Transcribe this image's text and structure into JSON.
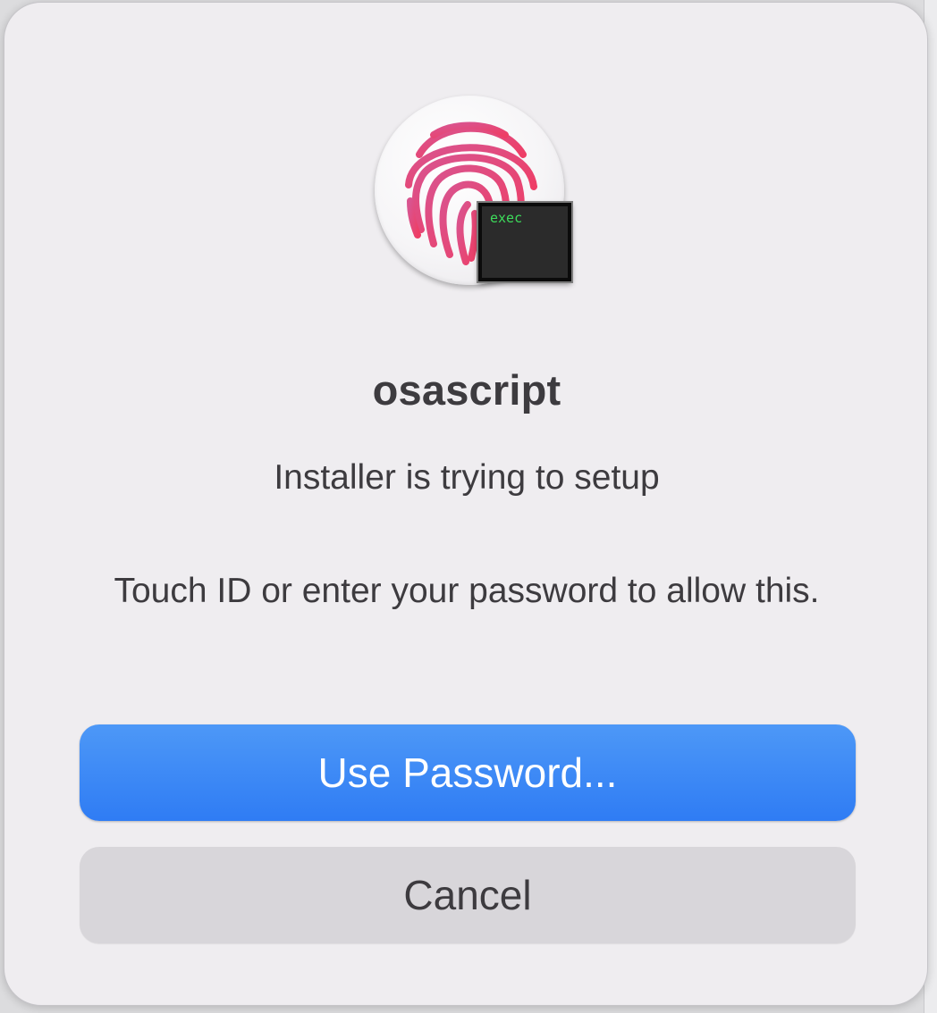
{
  "dialog": {
    "app_icon": "touch-id-fingerprint-icon",
    "badge_icon": "terminal-exec-icon",
    "badge_text": "exec",
    "title": "osascript",
    "message": "Installer is trying to setup",
    "info": "Touch ID or enter your password to allow this.",
    "primary_button": "Use Password...",
    "secondary_button": "Cancel"
  },
  "colors": {
    "fingerprint": "#e14f8e",
    "primary_button": "#3a86f6",
    "secondary_button": "#d8d6da",
    "badge_text": "#3ddc5b"
  }
}
